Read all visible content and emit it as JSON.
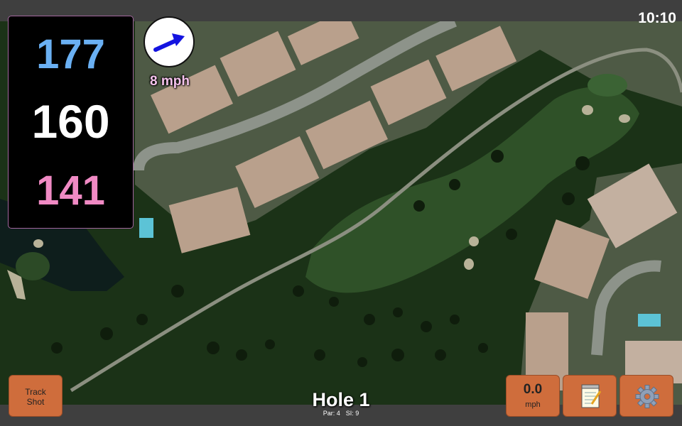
{
  "status": {
    "time": "10:10"
  },
  "distances": {
    "back": "177",
    "center": "160",
    "front": "141",
    "colors": {
      "back": "#6ab0f3",
      "center": "#ffffff",
      "front": "#f08ac4"
    }
  },
  "wind": {
    "speed_label": "8 mph",
    "label_color": "#f4c2ec",
    "arrow_color": "#1414e0",
    "icon": "wind-direction-arrow-icon"
  },
  "buttons": {
    "track_shot": [
      "Track",
      "Shot"
    ],
    "wind_value": "0.0",
    "wind_unit": "mph",
    "notes_icon": "notepad-icon",
    "settings_icon": "gear-icon"
  },
  "hole": {
    "title": "Hole 1",
    "par": "Par: 4",
    "si": "SI: 9"
  },
  "colors": {
    "button": "#cf6d3c",
    "panel_border": "#a2669e",
    "bar": "#3f3f3f"
  }
}
